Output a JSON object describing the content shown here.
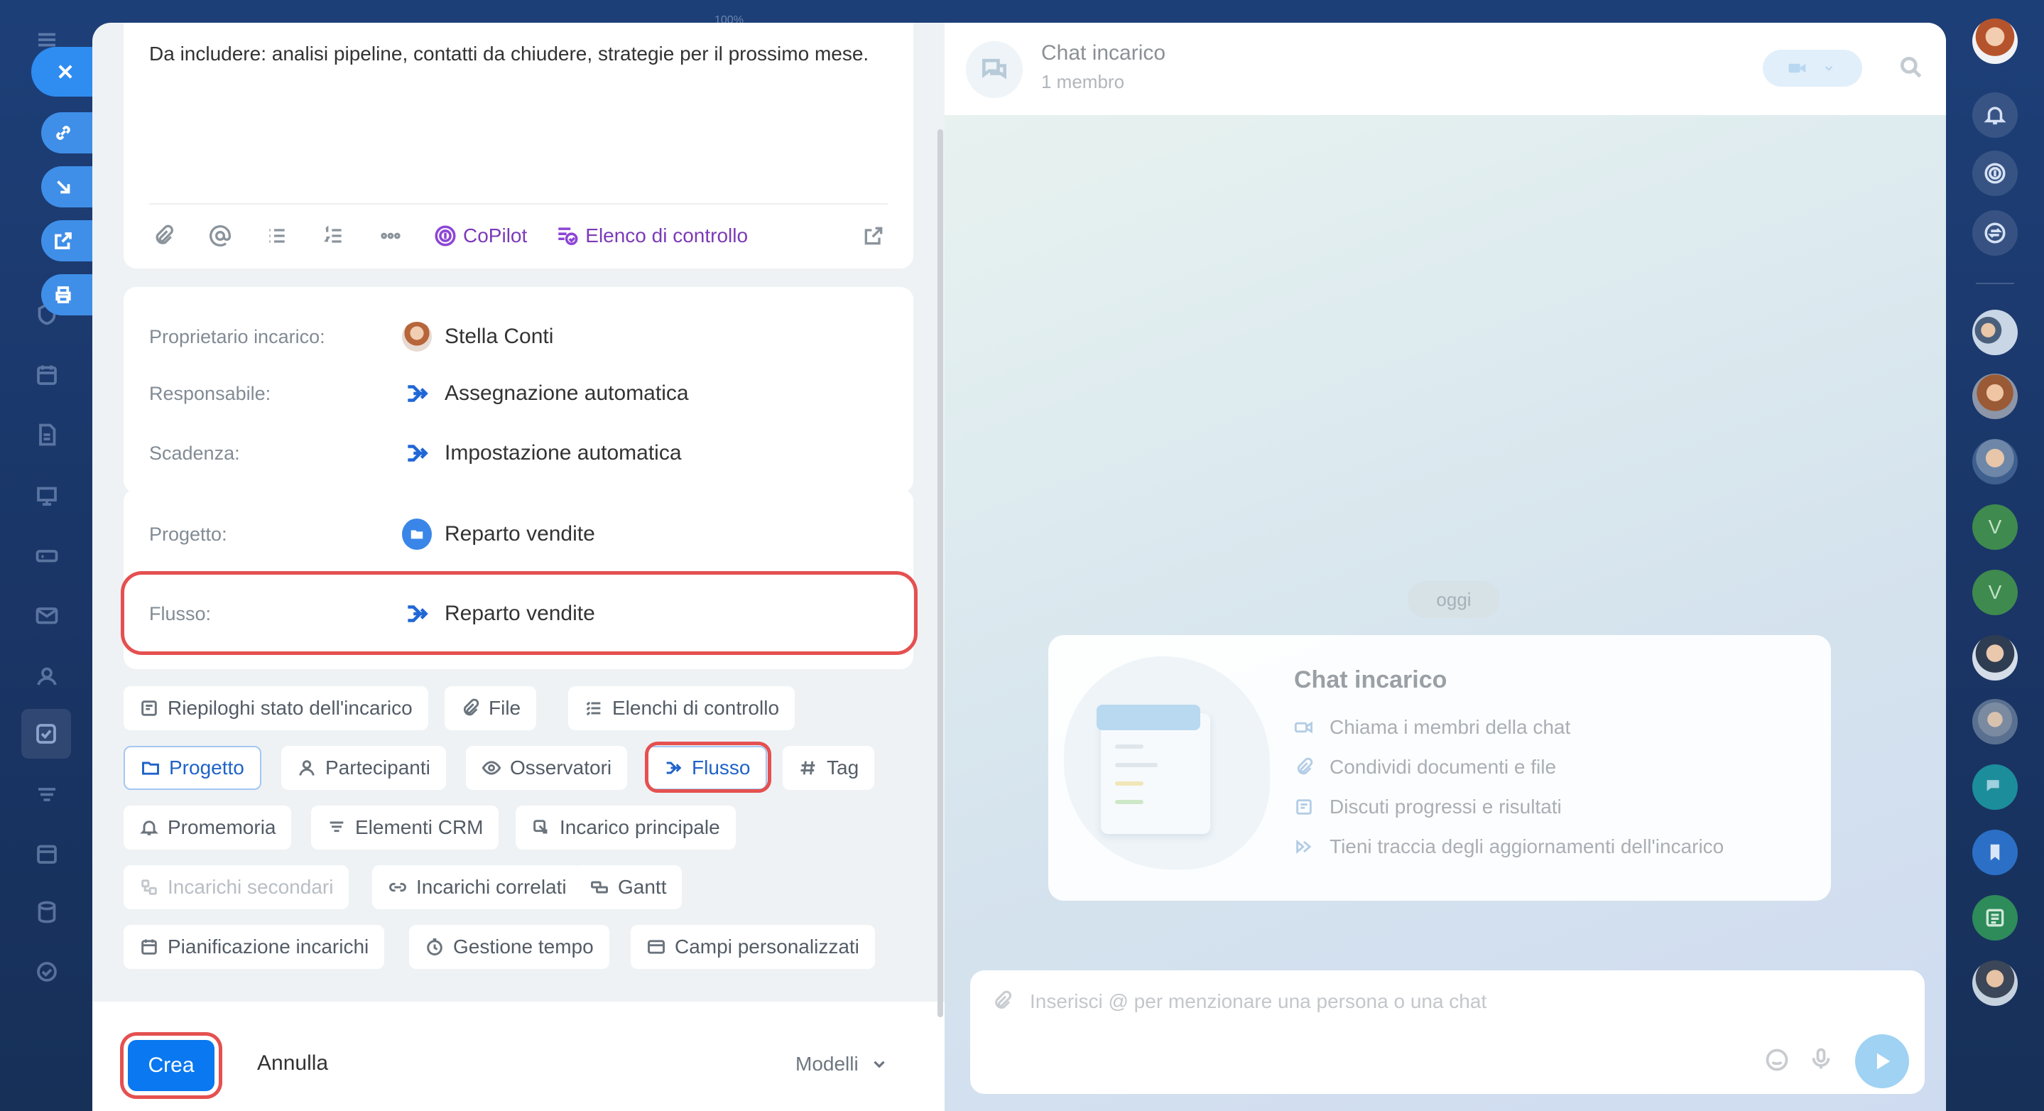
{
  "app": {
    "zoom_label": "100%"
  },
  "description": {
    "text": "Da includere: analisi pipeline, contatti da chiudere, strategie per il prossimo mese."
  },
  "toolbar": {
    "icons": [
      "paperclip-icon",
      "mention-icon",
      "bullet-list-icon",
      "numbered-list-icon",
      "more-icon"
    ],
    "copilot_label": "CoPilot",
    "checklist_label": "Elenco di controllo"
  },
  "people": {
    "owner_label": "Proprietario incarico:",
    "owner_value": "Stella Conti",
    "responsible_label": "Responsabile:",
    "responsible_value": "Assegnazione automatica",
    "deadline_label": "Scadenza:",
    "deadline_value": "Impostazione automatica"
  },
  "project": {
    "project_label": "Progetto:",
    "project_value": "Reparto vendite",
    "flow_label": "Flusso:",
    "flow_value": "Reparto vendite"
  },
  "chips": [
    {
      "label": "Riepiloghi stato dell'incarico",
      "icon": "summary-icon",
      "state": "normal"
    },
    {
      "label": "File",
      "icon": "paperclip-icon",
      "state": "normal"
    },
    {
      "label": "Elenchi di controllo",
      "icon": "checklist-icon",
      "state": "normal"
    },
    {
      "label": "Progetto",
      "icon": "folder-icon",
      "state": "selected"
    },
    {
      "label": "Partecipanti",
      "icon": "person-icon",
      "state": "normal"
    },
    {
      "label": "Osservatori",
      "icon": "eye-icon",
      "state": "normal"
    },
    {
      "label": "Flusso",
      "icon": "flow-icon",
      "state": "selected"
    },
    {
      "label": "Tag",
      "icon": "hash-icon",
      "state": "normal"
    },
    {
      "label": "Promemoria",
      "icon": "bell-icon",
      "state": "normal"
    },
    {
      "label": "Elementi CRM",
      "icon": "crm-icon",
      "state": "normal"
    },
    {
      "label": "Incarico principale",
      "icon": "parent-task-icon",
      "state": "normal"
    },
    {
      "label": "Incarichi secondari",
      "icon": "subtask-icon",
      "state": "disabled"
    },
    {
      "label": "Incarichi correlati",
      "icon": "link-icon",
      "state": "normal"
    },
    {
      "label": "Gantt",
      "icon": "gantt-icon",
      "state": "normal"
    },
    {
      "label": "Pianificazione incarichi",
      "icon": "calendar-icon",
      "state": "normal"
    },
    {
      "label": "Gestione tempo",
      "icon": "clock-icon",
      "state": "normal"
    },
    {
      "label": "Campi personalizzati",
      "icon": "fields-icon",
      "state": "normal"
    }
  ],
  "footer": {
    "create_label": "Crea",
    "cancel_label": "Annulla",
    "templates_label": "Modelli"
  },
  "chat": {
    "title": "Chat incarico",
    "members": "1 membro",
    "date_label": "oggi",
    "card_title": "Chat incarico",
    "features": [
      {
        "text": "Chiama i membri della chat",
        "icon": "video-icon"
      },
      {
        "text": "Condividi documenti e file",
        "icon": "paperclip-icon"
      },
      {
        "text": "Discuti progressi e risultati",
        "icon": "summary-icon"
      },
      {
        "text": "Tieni traccia degli aggiornamenti dell'incarico",
        "icon": "flow-icon"
      }
    ],
    "composer_placeholder": "Inserisci @ per menzionare una persona o una chat"
  },
  "right_rail": {
    "letters": [
      "V",
      "V"
    ]
  },
  "colors": {
    "accent": "#0a78f0",
    "highlight": "#e55050",
    "copilot": "#7b3ab8",
    "background": "#1d3f78"
  }
}
